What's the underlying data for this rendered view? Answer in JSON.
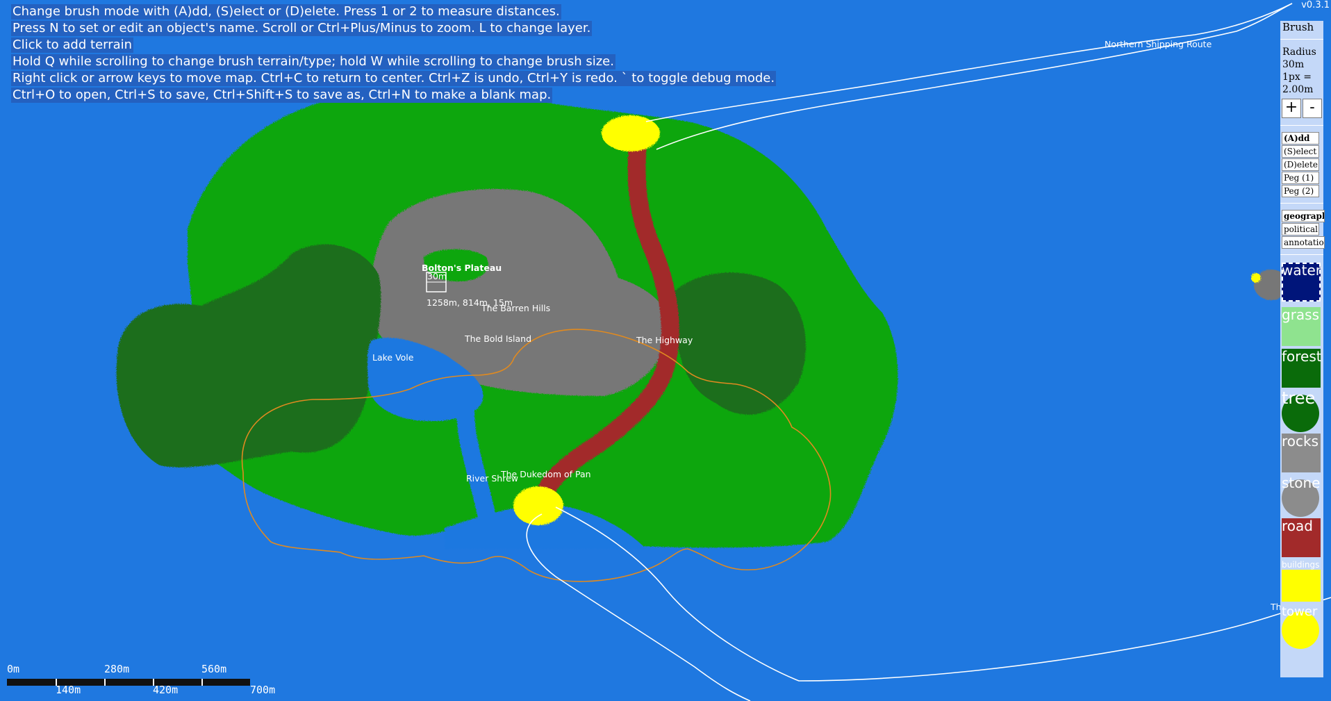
{
  "help_lines": [
    "Change brush mode with (A)dd, (S)elect or (D)elete. Press 1 or 2 to measure distances.",
    "Press N to set or edit an object's name. Scroll or Ctrl+Plus/Minus to zoom. L to change layer.",
    "Click to add terrain",
    "Hold Q while scrolling to change brush terrain/type; hold W while scrolling to change brush size.",
    "Right click or arrow keys to move map. Ctrl+C to return to center. Ctrl+Z is undo, Ctrl+Y is redo. ` to toggle debug mode.",
    "Ctrl+O to open, Ctrl+S to save, Ctrl+Shift+S to save as, Ctrl+N to make a blank map."
  ],
  "version": "v0.3.1",
  "map_labels": {
    "northern_route": "Northern Shipping Route",
    "plateau": "Bolton's Plateau",
    "plateau_marker": "30m",
    "cursor_readout": "1258m, 814m, 15m",
    "barren_hills": "The Barren Hills",
    "bold_island": "The Bold Island",
    "highway": "The Highway",
    "lake": "Lake Vole",
    "dukedom": "The Dukedom of Pan",
    "river": "River Shrew",
    "east_fragment": "Th"
  },
  "scale_bar": {
    "top_ticks": [
      "0m",
      "280m",
      "560m"
    ],
    "bottom_ticks": [
      "140m",
      "420m",
      "700m"
    ]
  },
  "panel": {
    "title": "Brush",
    "radius_label": "Radius",
    "radius_value": "30m",
    "scale_line1": "1px =",
    "scale_line2": "2.00m",
    "plus": "+",
    "minus": "-",
    "modes": [
      "(A)dd",
      "(S)elect",
      "(D)elete",
      "Peg (1)",
      "Peg (2)"
    ],
    "active_mode": "(A)dd",
    "layers": [
      "geography",
      "political",
      "annotation"
    ],
    "active_layer": "geography",
    "terrains": [
      {
        "name": "water",
        "color": "#00157a",
        "shape": "square"
      },
      {
        "name": "grass",
        "color": "#8fe38f",
        "shape": "square"
      },
      {
        "name": "forest",
        "color": "#0a6b0a",
        "shape": "square"
      },
      {
        "name": "tree",
        "color": "#0a6b0a",
        "shape": "circle"
      },
      {
        "name": "rocks",
        "color": "#8c8c8c",
        "shape": "square"
      },
      {
        "name": "stone",
        "color": "#8c8c8c",
        "shape": "circle"
      },
      {
        "name": "road",
        "color": "#a22a2a",
        "shape": "square"
      },
      {
        "name": "buildings",
        "color": "#ffff00",
        "shape": "square"
      },
      {
        "name": "tower",
        "color": "#ffff00",
        "shape": "circle"
      }
    ]
  },
  "colors": {
    "water": "#1f78e0",
    "grass": "#0aa60a",
    "forest": "#1e6e1e",
    "rocks": "#7a7a7a",
    "road": "#a22a2a",
    "buildings": "#ffff00",
    "border": "#e08a20",
    "route": "#ffffff"
  }
}
